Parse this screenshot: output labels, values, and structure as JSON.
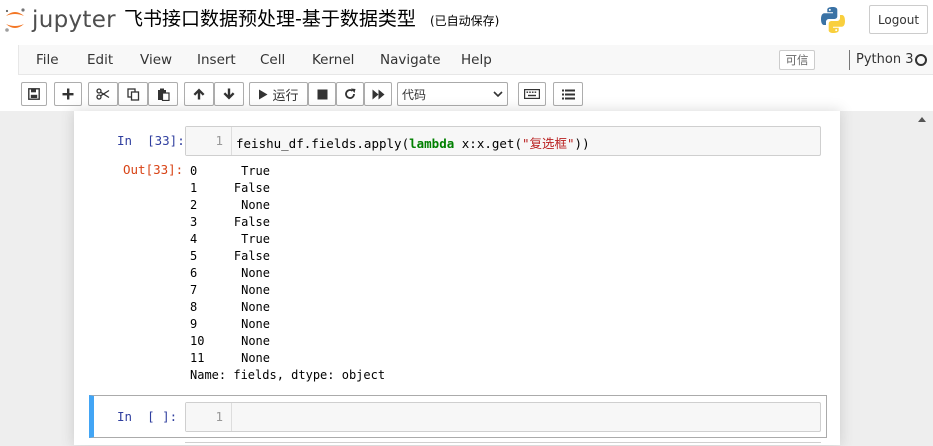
{
  "header": {
    "logo_text": "jupyter",
    "notebook_title": "飞书接口数据预处理-基于数据类型",
    "save_status": "(已自动保存)",
    "logout_label": "Logout"
  },
  "menu": {
    "items": [
      "File",
      "Edit",
      "View",
      "Insert",
      "Cell",
      "Kernel",
      "Navigate",
      "Help"
    ],
    "trusted_label": "可信",
    "kernel_name": "Python 3"
  },
  "toolbar": {
    "run_label": "运行",
    "cell_type": "代码"
  },
  "cells": [
    {
      "in_prompt": "In  [33]:",
      "line_number": "1",
      "code_prefix": "feishu_df.fields.apply(",
      "code_keyword": "lambda",
      "code_middle": " x:x.get(",
      "code_string": "\"复选框\"",
      "code_suffix": "))",
      "out_prompt": "Out[33]:",
      "output_rows": [
        {
          "index": "0",
          "value": "True"
        },
        {
          "index": "1",
          "value": "False"
        },
        {
          "index": "2",
          "value": "None"
        },
        {
          "index": "3",
          "value": "False"
        },
        {
          "index": "4",
          "value": "True"
        },
        {
          "index": "5",
          "value": "False"
        },
        {
          "index": "6",
          "value": "None"
        },
        {
          "index": "7",
          "value": "None"
        },
        {
          "index": "8",
          "value": "None"
        },
        {
          "index": "9",
          "value": "None"
        },
        {
          "index": "10",
          "value": "None"
        },
        {
          "index": "11",
          "value": "None"
        }
      ],
      "output_footer": "Name: fields, dtype: object"
    },
    {
      "in_prompt": "In  [ ]:",
      "line_number": "1"
    }
  ]
}
